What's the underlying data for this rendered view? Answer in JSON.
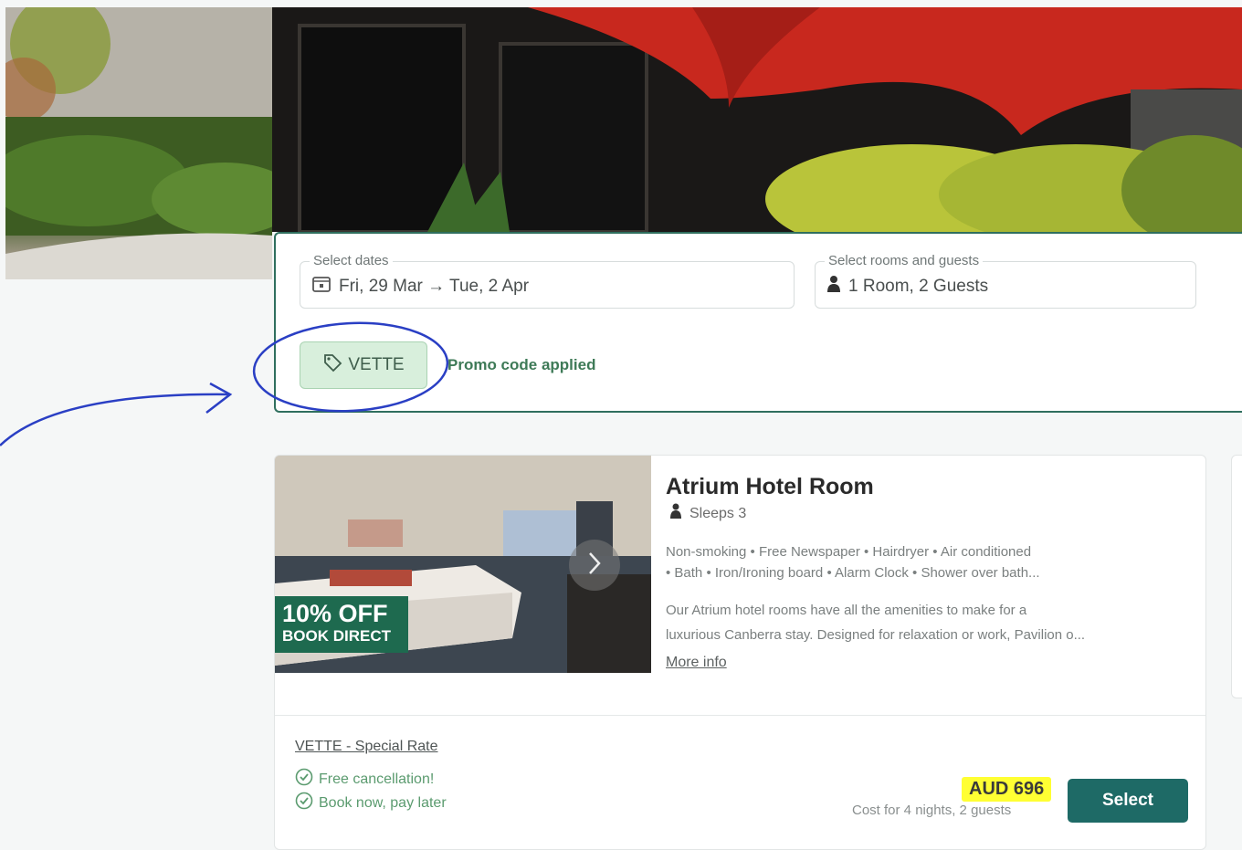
{
  "booking": {
    "dates_label": "Select dates",
    "dates_value": "Fri, 29 Mar → Tue, 2 Apr",
    "guests_label": "Select rooms and guests",
    "guests_value": "1 Room, 2 Guests",
    "promo_code": "VETTE",
    "promo_status": "Promo code applied"
  },
  "room": {
    "badge_line1": "10% OFF",
    "badge_line2": "BOOK DIRECT",
    "title": "Atrium Hotel Room",
    "sleeps": "Sleeps 3",
    "amenities_line1": "Non-smoking • Free Newspaper • Hairdryer • Air conditioned",
    "amenities_line2": "• Bath • Iron/Ironing board • Alarm Clock • Shower over bath...",
    "description_line1": "Our Atrium hotel rooms have all the amenities to make for a",
    "description_line2": "luxurious Canberra stay. Designed for relaxation or work, Pavilion o...",
    "more_info": "More info"
  },
  "rate": {
    "name": "VETTE - Special Rate",
    "perks": [
      "Free cancellation!",
      "Book now, pay later"
    ],
    "price": "AUD 696",
    "price_note": "Cost for 4 nights, 2 guests",
    "select_label": "Select"
  },
  "colors": {
    "brand": "#1e6a66",
    "promo_chip": "#d8efdc",
    "price_highlight": "#ffff33",
    "annotation_ink": "#2a3fc4"
  },
  "icons": [
    "calendar-icon",
    "person-icon",
    "tag-icon",
    "chevron-right-icon",
    "check-circle-icon"
  ]
}
